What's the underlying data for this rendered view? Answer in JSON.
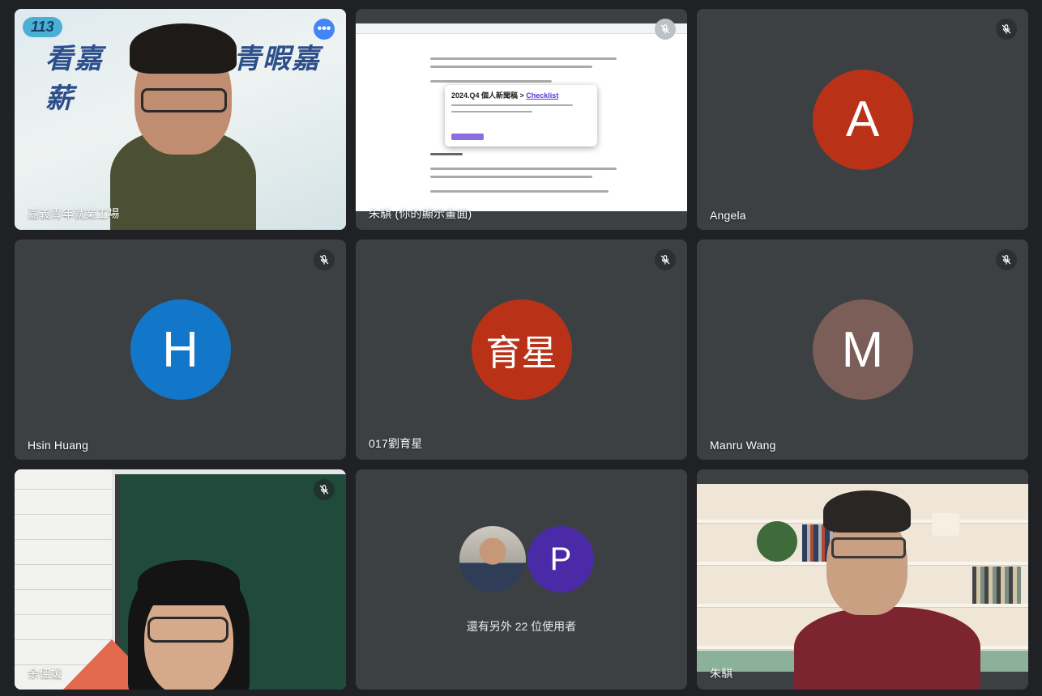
{
  "participants": [
    {
      "name": "嘉義青年就業工場",
      "kind": "video",
      "banner": "看嘉",
      "banner2": "青暇嘉薪",
      "badge": "113"
    },
    {
      "name": "朱騏 (你的顯示畫面)",
      "kind": "screen",
      "popup_title": "2024.Q4 個人新聞稿 > ",
      "popup_link": "Checklist"
    },
    {
      "name": "Angela",
      "kind": "avatar",
      "initial": "A",
      "color": "#b93218"
    },
    {
      "name": "Hsin Huang",
      "kind": "avatar",
      "initial": "H",
      "color": "#1277c8"
    },
    {
      "name": "017劉育星",
      "kind": "avatar",
      "initial": "育星",
      "color": "#b93218"
    },
    {
      "name": "Manru Wang",
      "kind": "avatar",
      "initial": "M",
      "color": "#7a5e57"
    },
    {
      "name": "余佳媛",
      "kind": "video"
    },
    {
      "name": "",
      "kind": "group",
      "caption": "還有另外 22 位使用者",
      "initial": "P",
      "color": "#4a2aa7"
    },
    {
      "name": "朱騏",
      "kind": "video"
    }
  ],
  "icons": {
    "mute": "mic-off-icon",
    "more": "more-options-icon"
  }
}
